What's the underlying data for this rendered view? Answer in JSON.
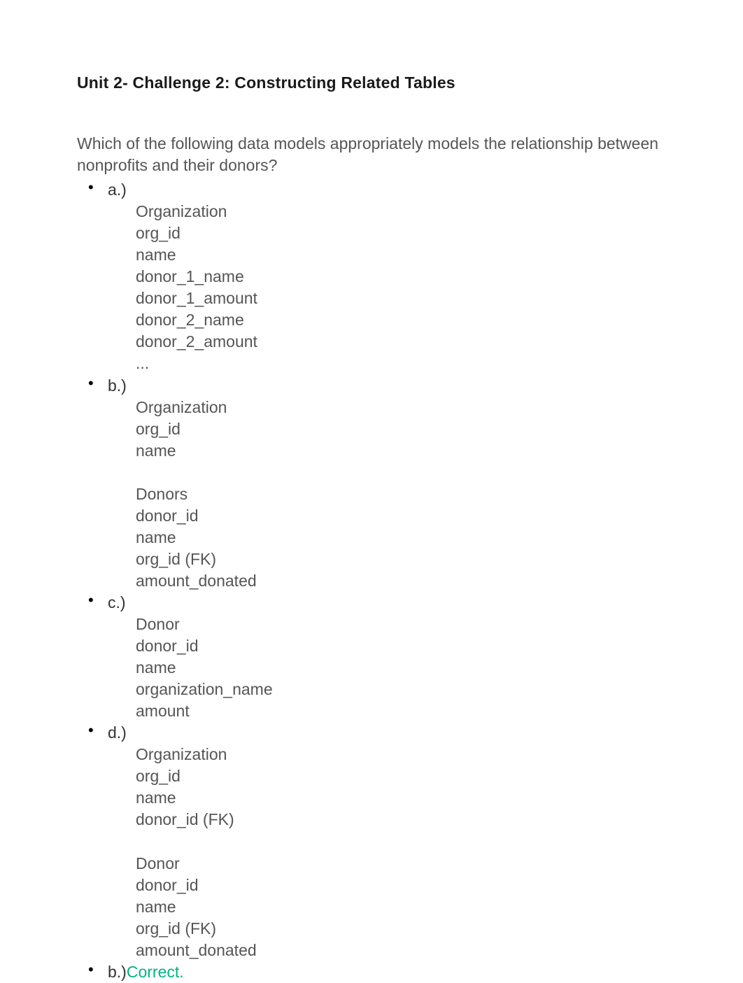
{
  "title": "Unit 2- Challenge 2: Constructing Related Tables",
  "question": "Which of the following data models appropriately models the relationship between nonprofits and their donors?",
  "options": {
    "a": {
      "label": "a.)",
      "body": "Organization\norg_id\nname\ndonor_1_name\ndonor_1_amount\ndonor_2_name\ndonor_2_amount\n..."
    },
    "b": {
      "label": "b.)",
      "body": "Organization\norg_id\nname\n\nDonors\ndonor_id\nname\norg_id (FK)\namount_donated"
    },
    "c": {
      "label": "c.)",
      "body": "Donor\ndonor_id\nname\norganization_name\namount"
    },
    "d": {
      "label": "d.)",
      "body": "Organization\norg_id\nname\ndonor_id (FK)\n\nDonor\ndonor_id\nname\norg_id (FK)\namount_donated"
    }
  },
  "answer": {
    "label": "b.)",
    "status": "Correct."
  }
}
